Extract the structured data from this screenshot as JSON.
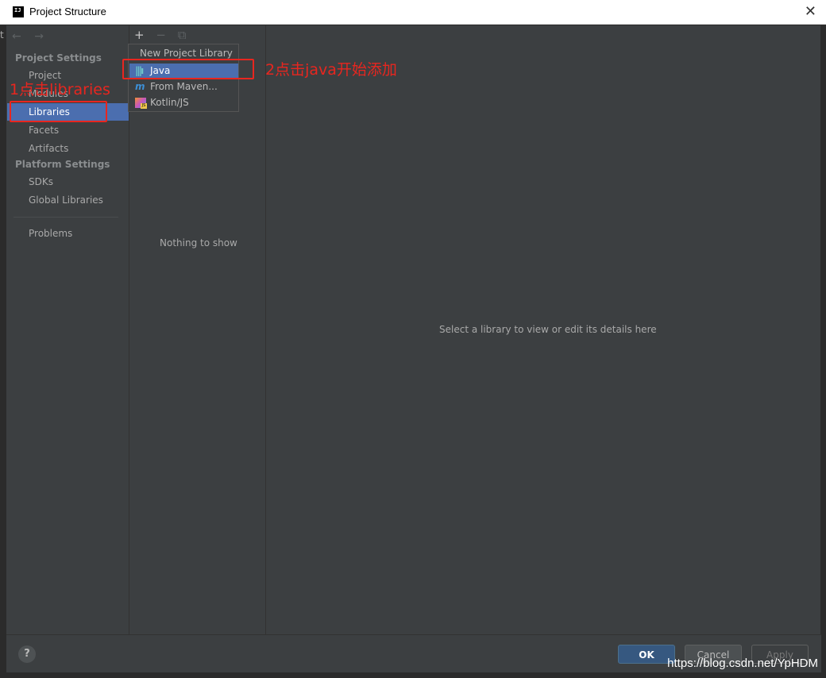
{
  "window": {
    "title": "Project Structure"
  },
  "nav": {
    "back": "←",
    "forward": "→"
  },
  "sidebar": {
    "project_settings_heading": "Project Settings",
    "items_project": [
      {
        "label": "Project"
      },
      {
        "label": "Modules"
      },
      {
        "label": "Libraries"
      },
      {
        "label": "Facets"
      },
      {
        "label": "Artifacts"
      }
    ],
    "platform_settings_heading": "Platform Settings",
    "items_platform": [
      {
        "label": "SDKs"
      },
      {
        "label": "Global Libraries"
      }
    ],
    "problems": "Problems"
  },
  "libraries": {
    "add": "+",
    "remove": "−",
    "copy": "⧉",
    "empty": "Nothing to show"
  },
  "popup": {
    "header": "New Project Library",
    "items": [
      {
        "label": "Java",
        "icon": "java-library-icon"
      },
      {
        "label": "From Maven...",
        "icon": "maven-icon"
      },
      {
        "label": "Kotlin/JS",
        "icon": "kotlin-js-icon"
      }
    ]
  },
  "detail": {
    "message": "Select a library to view or edit its details here"
  },
  "footer": {
    "help": "?",
    "ok": "OK",
    "cancel": "Cancel",
    "apply": "Apply"
  },
  "annotations": {
    "step1": "1点击libraries",
    "step2": "2点击java开始添加",
    "color": "#e8261f"
  },
  "watermark": "https://blog.csdn.net/YpHDM",
  "colors": {
    "selection": "#4b6eaf",
    "background": "#3c3f41",
    "ok_button": "#365880"
  }
}
